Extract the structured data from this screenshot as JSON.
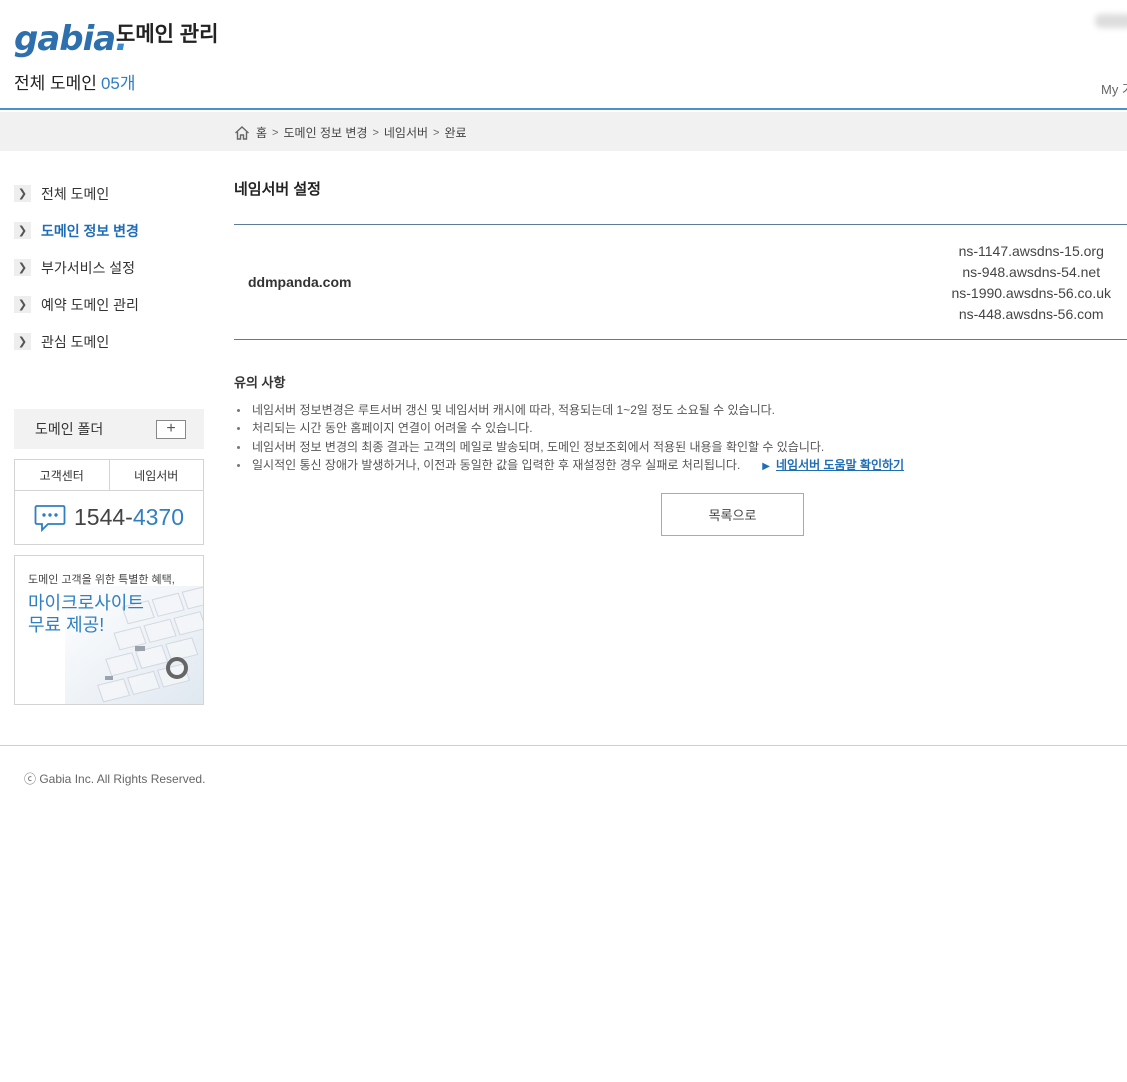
{
  "header": {
    "logo": "gabia",
    "logo_dot": ".",
    "title": "도메인 관리",
    "total_label": "전체 도메인",
    "total_count": "05개",
    "my_link": "My 가"
  },
  "breadcrumb": {
    "items": [
      "홈",
      "도메인 정보 변경",
      "네임서버",
      "완료"
    ],
    "separator": ">"
  },
  "sidebar": {
    "items": [
      {
        "label": "전체 도메인",
        "active": false
      },
      {
        "label": "도메인 정보 변경",
        "active": true
      },
      {
        "label": "부가서비스 설정",
        "active": false
      },
      {
        "label": "예약 도메인 관리",
        "active": false
      },
      {
        "label": "관심 도메인",
        "active": false
      }
    ],
    "folder_label": "도메인 폴더",
    "folder_add": "+",
    "support_tabs": [
      "고객센터",
      "네임서버"
    ],
    "phone_prefix": "1544-",
    "phone_suffix": "4370",
    "promo_small": "도메인 고객을 위한 특별한 혜택,",
    "promo_big_line1": "마이크로사이트",
    "promo_big_line2": "무료 제공!"
  },
  "main": {
    "section_title": "네임서버 설정",
    "domain": "ddmpanda.com",
    "nameservers": [
      "ns-1147.awsdns-15.org",
      "ns-948.awsdns-54.net",
      "ns-1990.awsdns-56.co.uk",
      "ns-448.awsdns-56.com"
    ],
    "notice_title": "유의 사항",
    "notices": [
      "네임서버 정보변경은 루트서버 갱신 및 네임서버 캐시에 따라, 적용되는데 1~2일 정도 소요될 수 있습니다.",
      "처리되는 시간 동안 홈페이지 연결이 어려울 수 있습니다.",
      "네임서버 정보 변경의 최종 결과는 고객의 메일로 발송되며, 도메인 정보조회에서 적용된 내용을 확인할 수 있습니다.",
      "일시적인 통신 장애가 발생하거나, 이전과 동일한 값을 입력한 후 재설정한 경우 실패로 처리됩니다."
    ],
    "help_link": "네임서버 도움말 확인하기",
    "list_button": "목록으로"
  },
  "footer": {
    "copyright": "ⓒ Gabia Inc. All Rights Reserved."
  },
  "colors": {
    "accent": "#2f7fc1",
    "header_line": "#4a90c9",
    "table_line": "#5d7b98"
  }
}
